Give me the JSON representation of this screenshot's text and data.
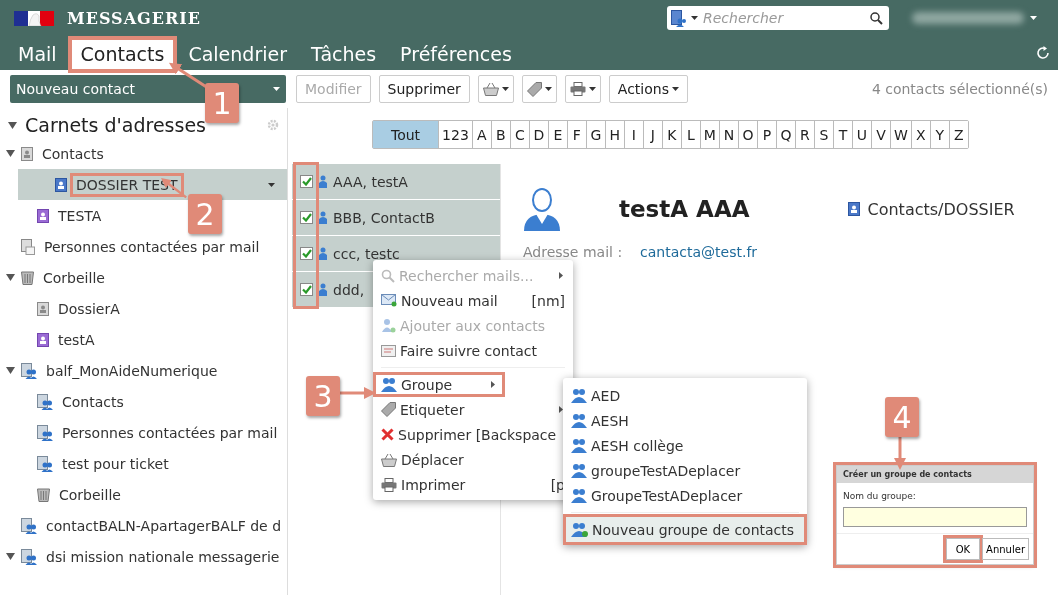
{
  "header": {
    "title": "MESSAGERIE",
    "search": {
      "placeholder": "Rechercher"
    }
  },
  "nav_tabs": [
    {
      "label": "Mail",
      "selected": false,
      "highlighted": false
    },
    {
      "label": "Contacts",
      "selected": true,
      "highlighted": true
    },
    {
      "label": "Calendrier",
      "selected": false,
      "highlighted": false
    },
    {
      "label": "Tâches",
      "selected": false,
      "highlighted": false
    },
    {
      "label": "Préférences",
      "selected": false,
      "highlighted": false
    }
  ],
  "toolbar": {
    "new_contact": "Nouveau contact",
    "buttons": [
      {
        "label": "Modifier",
        "disabled": true
      },
      {
        "label": "Supprimer",
        "disabled": false
      }
    ],
    "actions": "Actions",
    "selection_count": "4 contacts sélectionné(s)"
  },
  "sidebar": {
    "title": "Carnets d'adresses",
    "items": [
      {
        "label": "Contacts",
        "kind": "book",
        "expanded": true,
        "selected": false,
        "highlighted": false,
        "children": [
          {
            "label": "DOSSIER TEST",
            "kind": "book-blue",
            "selected": true,
            "highlighted": true
          },
          {
            "label": "TESTA",
            "kind": "book-purple",
            "selected": false,
            "highlighted": false
          }
        ]
      },
      {
        "label": "Personnes contactées par mail",
        "kind": "recent",
        "selected": false,
        "highlighted": false
      },
      {
        "label": "Corbeille",
        "kind": "trash",
        "expanded": true,
        "selected": false,
        "highlighted": false,
        "children": [
          {
            "label": "DossierA",
            "kind": "book",
            "selected": false,
            "highlighted": false
          },
          {
            "label": "testA",
            "kind": "book-purple",
            "selected": false,
            "highlighted": false
          }
        ]
      },
      {
        "label": "balf_MonAideNumerique",
        "kind": "shared",
        "expanded": true,
        "selected": false,
        "highlighted": false,
        "children": [
          {
            "label": "Contacts",
            "kind": "shared",
            "selected": false,
            "highlighted": false
          },
          {
            "label": "Personnes contactées par mail",
            "kind": "shared",
            "selected": false,
            "highlighted": false
          },
          {
            "label": "test pour ticket",
            "kind": "shared",
            "selected": false,
            "highlighted": false
          },
          {
            "label": "Corbeille",
            "kind": "trash",
            "selected": false,
            "highlighted": false
          }
        ]
      },
      {
        "label": "contactBALN-ApartagerBALF de d",
        "kind": "shared",
        "selected": false,
        "highlighted": false
      },
      {
        "label": "dsi mission nationale messagerie",
        "kind": "shared",
        "expanded": true,
        "selected": false,
        "highlighted": false
      }
    ]
  },
  "letters": [
    {
      "label": "Tout",
      "selected": true
    },
    {
      "label": "123",
      "selected": false
    },
    {
      "label": "A",
      "selected": false
    },
    {
      "label": "B",
      "selected": false
    },
    {
      "label": "C",
      "selected": false
    },
    {
      "label": "D",
      "selected": false
    },
    {
      "label": "E",
      "selected": false
    },
    {
      "label": "F",
      "selected": false
    },
    {
      "label": "G",
      "selected": false
    },
    {
      "label": "H",
      "selected": false
    },
    {
      "label": "I",
      "selected": false
    },
    {
      "label": "J",
      "selected": false
    },
    {
      "label": "K",
      "selected": false
    },
    {
      "label": "L",
      "selected": false
    },
    {
      "label": "M",
      "selected": false
    },
    {
      "label": "N",
      "selected": false
    },
    {
      "label": "O",
      "selected": false
    },
    {
      "label": "P",
      "selected": false
    },
    {
      "label": "Q",
      "selected": false
    },
    {
      "label": "R",
      "selected": false
    },
    {
      "label": "S",
      "selected": false
    },
    {
      "label": "T",
      "selected": false
    },
    {
      "label": "U",
      "selected": false
    },
    {
      "label": "V",
      "selected": false
    },
    {
      "label": "W",
      "selected": false
    },
    {
      "label": "X",
      "selected": false
    },
    {
      "label": "Y",
      "selected": false
    },
    {
      "label": "Z",
      "selected": false
    }
  ],
  "contact_list": {
    "checkboxes_highlighted": true,
    "rows": [
      {
        "name": "AAA, testA",
        "checked": true,
        "selected": true
      },
      {
        "name": "BBB, ContactB",
        "checked": true,
        "selected": true
      },
      {
        "name": "ccc, testc",
        "checked": true,
        "selected": true
      },
      {
        "name": "ddd,",
        "checked": true,
        "selected": true
      }
    ]
  },
  "detail": {
    "name": "testA AAA",
    "book": "Contacts/DOSSIER",
    "email_label": "Adresse mail :",
    "email": "cantacta@test.fr"
  },
  "context_menu": {
    "items": [
      {
        "label": "Rechercher mails...",
        "kind": "search",
        "disabled": true,
        "submenu": true,
        "separator_before": false,
        "highlighted": false
      },
      {
        "label": "Nouveau mail",
        "shortcut": "[nm]",
        "kind": "mail",
        "disabled": false,
        "submenu": false,
        "separator_before": false,
        "highlighted": false
      },
      {
        "label": "Ajouter aux contacts",
        "kind": "person-add",
        "disabled": true,
        "submenu": false,
        "separator_before": false,
        "highlighted": false
      },
      {
        "label": "Faire suivre contact",
        "kind": "card",
        "disabled": false,
        "submenu": false,
        "separator_before": false,
        "highlighted": false
      },
      {
        "label": "Groupe",
        "kind": "group",
        "disabled": false,
        "submenu": true,
        "separator_before": true,
        "highlighted": true
      },
      {
        "label": "Etiqueter",
        "kind": "tag",
        "disabled": false,
        "submenu": true,
        "separator_before": false,
        "highlighted": false
      },
      {
        "label": "Supprimer [Backspace",
        "kind": "delete",
        "disabled": false,
        "submenu": false,
        "separator_before": false,
        "highlighted": false
      },
      {
        "label": "Déplacer",
        "kind": "basket",
        "disabled": false,
        "submenu": false,
        "separator_before": false,
        "highlighted": false
      },
      {
        "label": "Imprimer",
        "shortcut": "[p",
        "kind": "printer",
        "disabled": false,
        "submenu": false,
        "separator_before": false,
        "highlighted": false
      }
    ]
  },
  "group_submenu": {
    "items": [
      {
        "label": "AED",
        "kind": "group",
        "separator_before": false,
        "highlighted": false
      },
      {
        "label": "AESH",
        "kind": "group",
        "separator_before": false,
        "highlighted": false
      },
      {
        "label": "AESH collège",
        "kind": "group",
        "separator_before": false,
        "highlighted": false
      },
      {
        "label": "groupeTestADeplacer",
        "kind": "group",
        "separator_before": false,
        "highlighted": false
      },
      {
        "label": "GroupeTestADeplacer",
        "kind": "group",
        "separator_before": false,
        "highlighted": false
      },
      {
        "label": "Nouveau groupe de contacts",
        "kind": "group-add",
        "separator_before": true,
        "highlighted": true
      }
    ]
  },
  "dialog": {
    "title": "Créer un groupe de contacts",
    "field_label": "Nom du groupe:",
    "highlighted": true,
    "buttons": [
      {
        "label": "OK",
        "highlighted": true
      },
      {
        "label": "Annuler",
        "highlighted": false
      }
    ]
  },
  "callouts": [
    {
      "label": "1"
    },
    {
      "label": "2"
    },
    {
      "label": "3"
    },
    {
      "label": "4"
    }
  ]
}
